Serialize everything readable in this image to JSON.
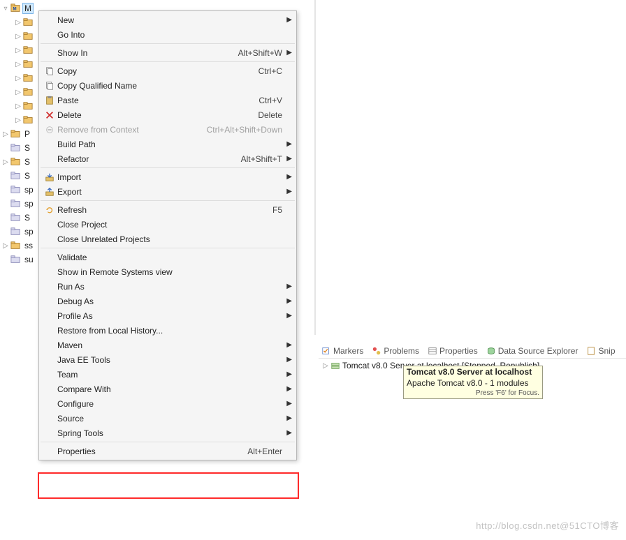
{
  "tree": {
    "root_label": "M",
    "items": [
      {
        "indent": 1,
        "arrow": "▷"
      },
      {
        "indent": 1,
        "arrow": "▷"
      },
      {
        "indent": 1,
        "arrow": "▷"
      },
      {
        "indent": 1,
        "arrow": "▷"
      },
      {
        "indent": 1,
        "arrow": "▷"
      },
      {
        "indent": 1,
        "arrow": "▷"
      },
      {
        "indent": 1,
        "arrow": "▷"
      },
      {
        "indent": 1,
        "arrow": "▷"
      },
      {
        "indent": 0,
        "arrow": "▷",
        "label": "P"
      },
      {
        "indent": 0,
        "arrow": "",
        "label": "S"
      },
      {
        "indent": 0,
        "arrow": "▷",
        "label": "S"
      },
      {
        "indent": 0,
        "arrow": "",
        "label": "S"
      },
      {
        "indent": 0,
        "arrow": "",
        "label": "sp"
      },
      {
        "indent": 0,
        "arrow": "",
        "label": "sp"
      },
      {
        "indent": 0,
        "arrow": "",
        "label": "S"
      },
      {
        "indent": 0,
        "arrow": "",
        "label": "sp"
      },
      {
        "indent": 0,
        "arrow": "▷",
        "label": "ss"
      },
      {
        "indent": 0,
        "arrow": "",
        "label": "su"
      }
    ]
  },
  "menu": {
    "items": [
      {
        "type": "item",
        "label": "New",
        "submenu": true
      },
      {
        "type": "item",
        "label": "Go Into"
      },
      {
        "type": "sep"
      },
      {
        "type": "item",
        "label": "Show In",
        "accel": "Alt+Shift+W",
        "submenu": true
      },
      {
        "type": "sep"
      },
      {
        "type": "item",
        "label": "Copy",
        "accel": "Ctrl+C",
        "icon": "copy"
      },
      {
        "type": "item",
        "label": "Copy Qualified Name",
        "icon": "copy"
      },
      {
        "type": "item",
        "label": "Paste",
        "accel": "Ctrl+V",
        "icon": "paste"
      },
      {
        "type": "item",
        "label": "Delete",
        "accel": "Delete",
        "icon": "delete"
      },
      {
        "type": "item",
        "label": "Remove from Context",
        "accel": "Ctrl+Alt+Shift+Down",
        "disabled": true,
        "icon": "remove"
      },
      {
        "type": "item",
        "label": "Build Path",
        "submenu": true
      },
      {
        "type": "item",
        "label": "Refactor",
        "accel": "Alt+Shift+T",
        "submenu": true
      },
      {
        "type": "sep"
      },
      {
        "type": "item",
        "label": "Import",
        "submenu": true,
        "icon": "import"
      },
      {
        "type": "item",
        "label": "Export",
        "submenu": true,
        "icon": "export"
      },
      {
        "type": "sep"
      },
      {
        "type": "item",
        "label": "Refresh",
        "accel": "F5",
        "icon": "refresh"
      },
      {
        "type": "item",
        "label": "Close Project"
      },
      {
        "type": "item",
        "label": "Close Unrelated Projects"
      },
      {
        "type": "sep"
      },
      {
        "type": "item",
        "label": "Validate"
      },
      {
        "type": "item",
        "label": "Show in Remote Systems view"
      },
      {
        "type": "item",
        "label": "Run As",
        "submenu": true
      },
      {
        "type": "item",
        "label": "Debug As",
        "submenu": true
      },
      {
        "type": "item",
        "label": "Profile As",
        "submenu": true
      },
      {
        "type": "item",
        "label": "Restore from Local History..."
      },
      {
        "type": "item",
        "label": "Maven",
        "submenu": true
      },
      {
        "type": "item",
        "label": "Java EE Tools",
        "submenu": true
      },
      {
        "type": "item",
        "label": "Team",
        "submenu": true
      },
      {
        "type": "item",
        "label": "Compare With",
        "submenu": true
      },
      {
        "type": "item",
        "label": "Configure",
        "submenu": true
      },
      {
        "type": "item",
        "label": "Source",
        "submenu": true
      },
      {
        "type": "item",
        "label": "Spring Tools",
        "submenu": true
      },
      {
        "type": "sep"
      },
      {
        "type": "item",
        "label": "Properties",
        "accel": "Alt+Enter"
      }
    ]
  },
  "view_tabs": [
    {
      "label": "Markers",
      "icon": "markers"
    },
    {
      "label": "Problems",
      "icon": "problems"
    },
    {
      "label": "Properties",
      "icon": "properties"
    },
    {
      "label": "Data Source Explorer",
      "icon": "datasource"
    },
    {
      "label": "Snip",
      "icon": "snippets"
    }
  ],
  "server": {
    "label": "Tomcat v8.0 Server at localhost  [Stopped, Republish]"
  },
  "tooltip": {
    "title": "Tomcat v8.0 Server at localhost",
    "body": "Apache Tomcat v8.0 - 1 modules",
    "hint": "Press 'F6' for Focus."
  },
  "watermark": "http://blog.csdn.net@51CTO博客"
}
